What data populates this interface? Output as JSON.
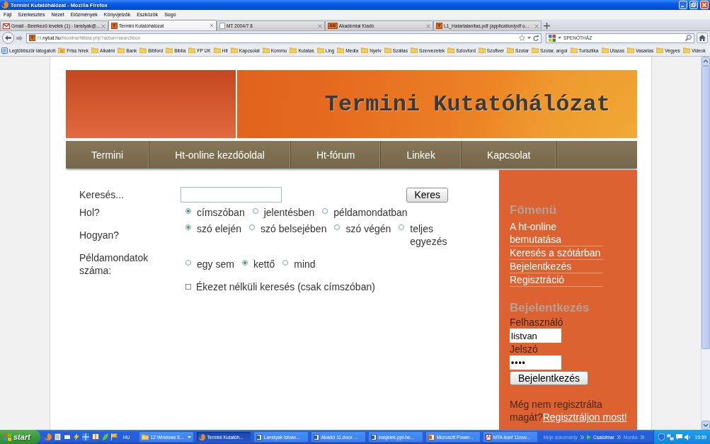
{
  "window": {
    "title": "Termini Kutatóhálózat - Mozilla Firefox"
  },
  "menu_bar": [
    "Fájl",
    "Szerkesztés",
    "Nézet",
    "Előzmények",
    "Könyvjelzők",
    "Eszközök",
    "Súgó"
  ],
  "tabs": [
    {
      "label": "Gmail - Beérkező levelek (1) - lanstyak@...",
      "selected": false,
      "kind": "mail"
    },
    {
      "label": "Termini Kutatóhálózat",
      "selected": true,
      "kind": "badge",
      "badge": "T"
    },
    {
      "label": "MT 2004/7 8",
      "selected": false,
      "kind": "blank"
    },
    {
      "label": "Akadémiai Kiadó",
      "selected": false,
      "kind": "badge",
      "badge": "AK"
    },
    {
      "label": "L1_Hatartalanitas.pdf (application/pdf o...",
      "selected": false,
      "kind": "badge",
      "badge": "T"
    }
  ],
  "address_bar": {
    "badge": "T",
    "subdomain": "ht.",
    "domain": "nytud.hu",
    "path": "/htonline/htlista.php?action=searchbox"
  },
  "search_bar": {
    "placeholder": "SPENÓTHÁZ"
  },
  "bookmarks": [
    {
      "label": "Legtöbbször látogatott",
      "kind": "recent"
    },
    {
      "label": "Friss hírek",
      "kind": "feed"
    },
    {
      "label": "Alkalmi",
      "kind": "folder"
    },
    {
      "label": "Bank",
      "kind": "folder"
    },
    {
      "label": "Bibford",
      "kind": "folder"
    },
    {
      "label": "Biblia",
      "kind": "folder"
    },
    {
      "label": "FP UK",
      "kind": "folder"
    },
    {
      "label": "Hit",
      "kind": "folder"
    },
    {
      "label": "Kapcsolat",
      "kind": "folder"
    },
    {
      "label": "Kommu",
      "kind": "folder"
    },
    {
      "label": "Kutatas",
      "kind": "folder"
    },
    {
      "label": "Ling",
      "kind": "folder"
    },
    {
      "label": "Media",
      "kind": "folder"
    },
    {
      "label": "Nyelv",
      "kind": "folder"
    },
    {
      "label": "Szallas",
      "kind": "folder"
    },
    {
      "label": "Szervezetek",
      "kind": "folder"
    },
    {
      "label": "Szlovford",
      "kind": "folder"
    },
    {
      "label": "Szoftver",
      "kind": "folder"
    },
    {
      "label": "Szotar",
      "kind": "folder"
    },
    {
      "label": "Szotar, angol",
      "kind": "folder"
    },
    {
      "label": "Turisztika",
      "kind": "folder"
    },
    {
      "label": "Utazas",
      "kind": "folder"
    },
    {
      "label": "Vasarlas",
      "kind": "folder"
    },
    {
      "label": "Vegyes",
      "kind": "folder"
    },
    {
      "label": "Videok",
      "kind": "folder"
    }
  ],
  "page": {
    "site_title": "Termini Kutatóhálózat",
    "nav": [
      "Termini",
      "Ht-online kezdőoldal",
      "Ht-fórum",
      "Linkek",
      "Kapcsolat"
    ],
    "search_form": {
      "search_label": "Keresés...",
      "search_button": "Keres",
      "option_groups": [
        {
          "label": "Hol?",
          "options": [
            {
              "label": "címszóban",
              "selected": true
            },
            {
              "label": "jelentésben",
              "selected": false
            },
            {
              "label": "példamondatban",
              "selected": false
            }
          ]
        },
        {
          "label": "Hogyan?",
          "options": [
            {
              "label": "szó elején",
              "selected": true
            },
            {
              "label": "szó belsejében",
              "selected": false
            },
            {
              "label": "szó végén",
              "selected": false
            },
            {
              "label": "teljes egyezés",
              "selected": false
            }
          ]
        },
        {
          "label": "Példamondatok száma:",
          "options": [
            {
              "label": "egy sem",
              "selected": false
            },
            {
              "label": "kettő",
              "selected": true
            },
            {
              "label": "mind",
              "selected": false
            }
          ]
        }
      ],
      "accent_option": {
        "label": "Ékezet nélküli keresés (csak címszóban)",
        "checked": false
      }
    },
    "sidebar": {
      "menu_title": "Főmenü",
      "menu_items": [
        "A ht-online bemutatása",
        "Keresés a szótárban",
        "Bejelentkezés",
        "Regisztráció"
      ],
      "login_title": "Bejelentkezés",
      "username_label": "Felhasználó",
      "username_value": "listvan",
      "password_label": "Jelszó",
      "password_value": "••••",
      "login_button": "Bejelentkezés",
      "register_prompt": "Még nem regisztrálta magát?",
      "register_link": "Regisztráljon most!"
    }
  },
  "taskbar": {
    "start": "start",
    "language": "HU",
    "tasks": [
      {
        "label": "12 Windows E...",
        "selected": false,
        "kind": "group"
      },
      {
        "label": "Termini Kutatóh...",
        "selected": true,
        "kind": "browser"
      },
      {
        "label": "Lanstyak Istvan...",
        "selected": false,
        "kind": "document"
      },
      {
        "label": "Akadci 11.docx ...",
        "selected": false,
        "kind": "document"
      },
      {
        "label": "Irasjelek.ppt-he...",
        "selected": false,
        "kind": "document"
      },
      {
        "label": "Microsoft Power...",
        "selected": false,
        "kind": "presentation"
      },
      {
        "label": "MTA-konf 11nov...",
        "selected": false,
        "kind": "pdf"
      }
    ],
    "toolbars": [
      {
        "label": "Moje dokumenty",
        "disabled": true
      },
      {
        "label": "Csatolmar",
        "disabled": false
      },
      {
        "label": "Munka",
        "disabled": true
      }
    ],
    "clock": "19:59"
  }
}
